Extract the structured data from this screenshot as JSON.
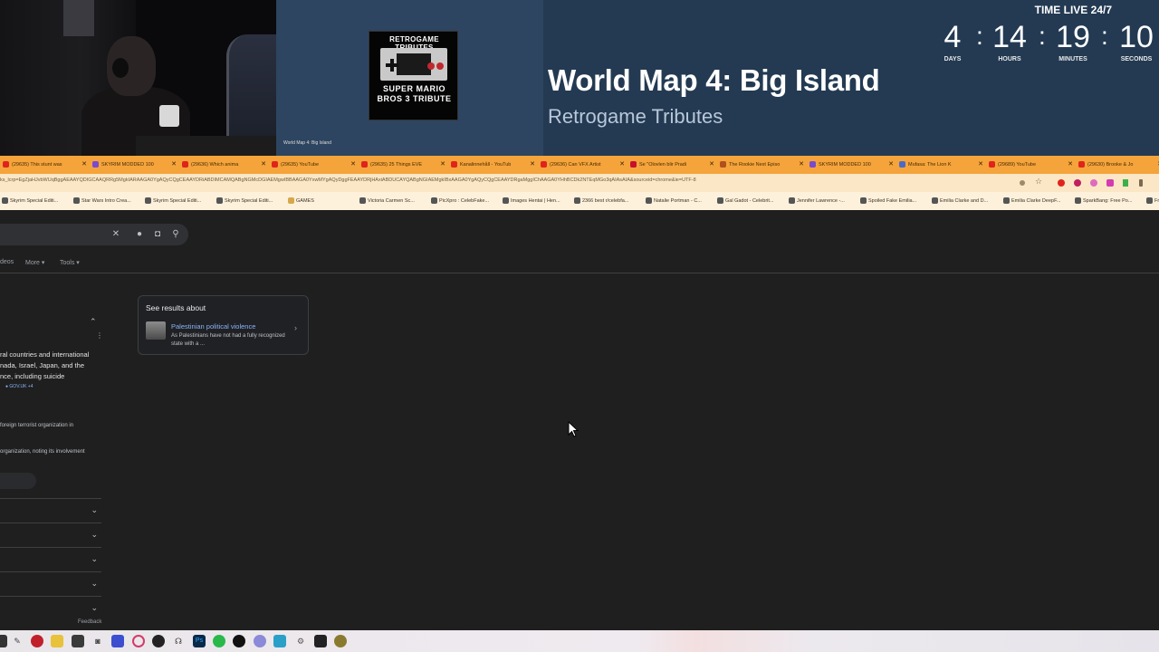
{
  "stream": {
    "song_title": "World Map 4: Big Island",
    "song_artist": "Retrogame Tributes",
    "album_top_text": "RETROGAME TRIBUTES",
    "album_bottom_text": "SUPER MARIO BROS 3 TRIBUTE",
    "cam_caption": "World Map 4: Big Island",
    "countdown_title": "TIME LIVE 24/7",
    "countdown": [
      {
        "value": "4",
        "label": "DAYS"
      },
      {
        "value": "14",
        "label": "HOURS"
      },
      {
        "value": "19",
        "label": "MINUTES"
      },
      {
        "value": "10",
        "label": "SECONDS"
      }
    ]
  },
  "browser": {
    "tabs": [
      {
        "title": "(29635) This stunt was",
        "icon": "youtube-icon"
      },
      {
        "title": "SKYRIM MODDED 100",
        "icon": "twitch-icon"
      },
      {
        "title": "(29636) Which anima",
        "icon": "youtube-icon"
      },
      {
        "title": "(29635) YouTube",
        "icon": "youtube-icon"
      },
      {
        "title": "(29635) 25 Things EVE",
        "icon": "youtube-icon"
      },
      {
        "title": "Kanalinnehåll - YouTub",
        "icon": "youtube-icon"
      },
      {
        "title": "(29636) Can VFX Artist",
        "icon": "youtube-icon"
      },
      {
        "title": "Se \"Olovlen blir Pradi",
        "icon": "pinterest-icon"
      },
      {
        "title": "The Rookie Next Episo",
        "icon": "calendar-icon"
      },
      {
        "title": "SKYRIM MODDED 100",
        "icon": "twitch-icon"
      },
      {
        "title": "Mufasa: The Lion K",
        "icon": "movie-icon"
      },
      {
        "title": "(29689) YouTube",
        "icon": "youtube-icon"
      },
      {
        "title": "(29630) Brooke & Jo",
        "icon": "youtube-icon"
      }
    ],
    "url": "ks_lcrp=EgZjaHJvbWUqBggAEAAYQDIGCAAQRRg5MgkIARAAGA0YgAQyCQgCEAAYDRiABDIMCAMQABgNGMcDGIAEMgwIBBAAGA0YxwMYgAQyDggFEAAYDRjHAxiABDUCAYQABgNGIAEMgkIBxAAGA0YgAQyCQgCEAAYDRgaMggIChAAGA0YHhBCDk2NTEqMGo3qAIAsAIA&sourceid=chrome&ie=UTF-8",
    "bookmarks": [
      {
        "label": "Skyrim Special Editi...",
        "folder": false
      },
      {
        "label": "Star Wars Intro Crea...",
        "folder": false
      },
      {
        "label": "Skyrim Special Editi...",
        "folder": false
      },
      {
        "label": "Skyrim Special Editi...",
        "folder": false
      },
      {
        "label": "GAMES",
        "folder": true
      },
      {
        "label": "Victoria Carmen Sc...",
        "folder": false
      },
      {
        "label": "PicXpro : CelebFake...",
        "folder": false
      },
      {
        "label": "Images Hentai | Hen...",
        "folder": false
      },
      {
        "label": "2366 best r/celebfa...",
        "folder": false
      },
      {
        "label": "Natalie Portman - C...",
        "folder": false
      },
      {
        "label": "Gal Gadot - Celebrit...",
        "folder": false
      },
      {
        "label": "Jennifer Lawrence -...",
        "folder": false
      },
      {
        "label": "Spoiled Fake Emilia...",
        "folder": false
      },
      {
        "label": "Emilia Clarke and D...",
        "folder": false
      },
      {
        "label": "Emilia Clarke DeepF...",
        "folder": false
      },
      {
        "label": "SparkBang: Free Po...",
        "folder": false
      },
      {
        "label": "Free Porn Videos D...",
        "folder": false
      }
    ]
  },
  "search": {
    "filters": {
      "videos": "deos",
      "more": "More",
      "tools": "Tools"
    },
    "side_card": {
      "heading": "See results about",
      "link": "Palestinian political violence",
      "snippet": "As Palestinians have not had a fully recognized state with a ..."
    },
    "left_lines": [
      "ral countries and international",
      "nada, Israel, Japan, and the",
      "nce, including suicide"
    ],
    "source_chip": "GOV.UK +4",
    "line2": "foreign terrorist organization in",
    "line3": "organization, noting its involvement",
    "feedback": "Feedback"
  }
}
